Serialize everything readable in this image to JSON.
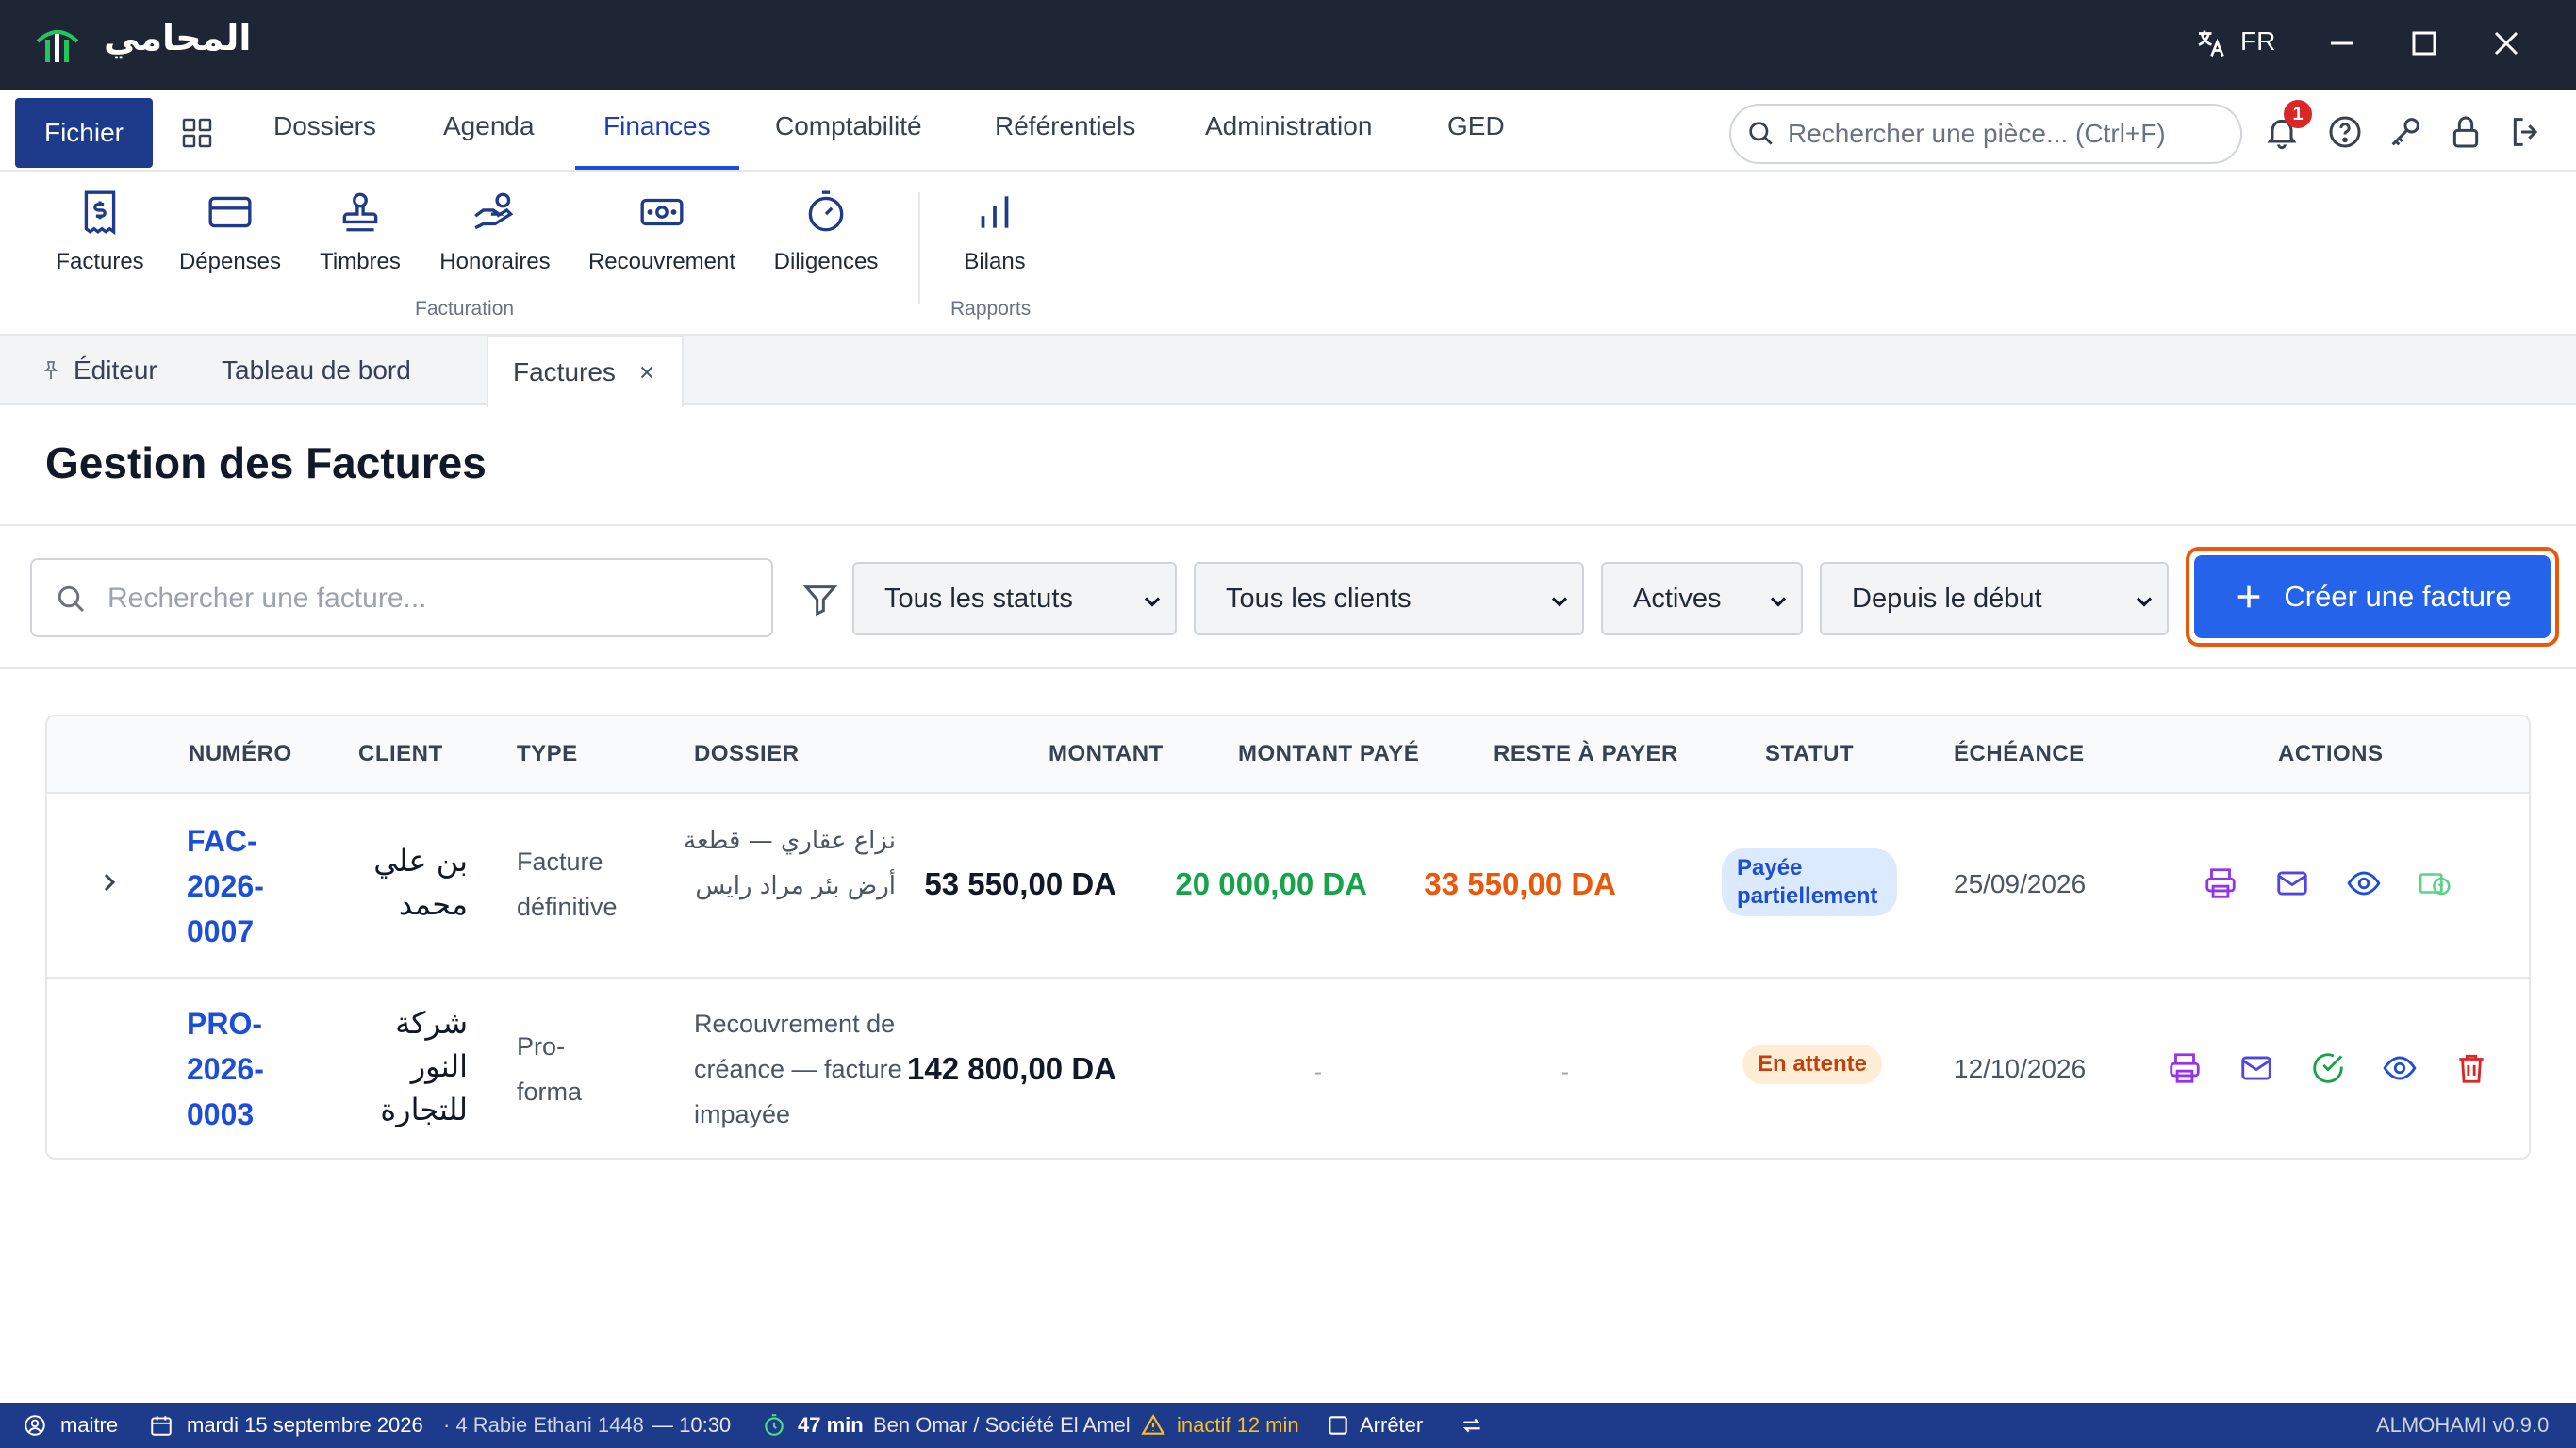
{
  "app": {
    "name": "المحامي",
    "lang": "FR"
  },
  "menu": {
    "fichier": "Fichier",
    "items": [
      "Dossiers",
      "Agenda",
      "Finances",
      "Comptabilité",
      "Référentiels",
      "Administration",
      "GED"
    ],
    "search_placeholder": "Rechercher une pièce... (Ctrl+F)",
    "notification_count": "1"
  },
  "ribbon": {
    "buttons": [
      "Factures",
      "Dépenses",
      "Timbres",
      "Honoraires",
      "Recouvrement",
      "Diligences",
      "Bilans"
    ],
    "groups": {
      "facturation": "Facturation",
      "rapports": "Rapports"
    }
  },
  "tabs": [
    "Éditeur",
    "Tableau de bord",
    "Factures"
  ],
  "page": {
    "title": "Gestion des Factures"
  },
  "filters": {
    "search_placeholder": "Rechercher une facture...",
    "status": "Tous les statuts",
    "client": "Tous les clients",
    "active": "Actives",
    "period": "Depuis le début",
    "create_label": "Créer une facture"
  },
  "table": {
    "headers": [
      "NUMÉRO",
      "CLIENT",
      "TYPE",
      "DOSSIER",
      "MONTANT",
      "MONTANT PAYÉ",
      "RESTE À PAYER",
      "STATUT",
      "ÉCHÉANCE",
      "ACTIONS"
    ],
    "rows": [
      {
        "numero": "FAC-2026-0007",
        "client": "بن علي محمد",
        "type": "Facture définitive",
        "dossier": "نزاع عقاري — قطعة أرض بئر مراد رايس",
        "montant": "53 550,00 DA",
        "paye": "20 000,00 DA",
        "reste": "33 550,00 DA",
        "statut": "Payée partiellement",
        "echeance": "25/09/2026"
      },
      {
        "numero": "PRO-2026-0003",
        "client": "شركة النور للتجارة",
        "type": "Pro-forma",
        "dossier": "Recouvrement de créance — facture impayée",
        "montant": "142 800,00 DA",
        "paye": "-",
        "reste": "-",
        "statut": "En attente",
        "echeance": "12/10/2026"
      }
    ]
  },
  "status_bar": {
    "user": "maitre",
    "date": "mardi 15 septembre 2026",
    "hijri": "· 4 Rabie Ethani 1448",
    "time": "— 10:30",
    "timer": "47 min",
    "context": "Ben Omar / Société El Amel",
    "inactive": "inactif 12 min",
    "stop": "Arrêter",
    "version": "ALMOHAMI v0.9.0"
  },
  "colors": {
    "accent": "#2563eb",
    "titlebar": "#1e2535",
    "statusbar": "#1e3a8a",
    "paid": "#16a34a",
    "rest": "#ea580c"
  }
}
